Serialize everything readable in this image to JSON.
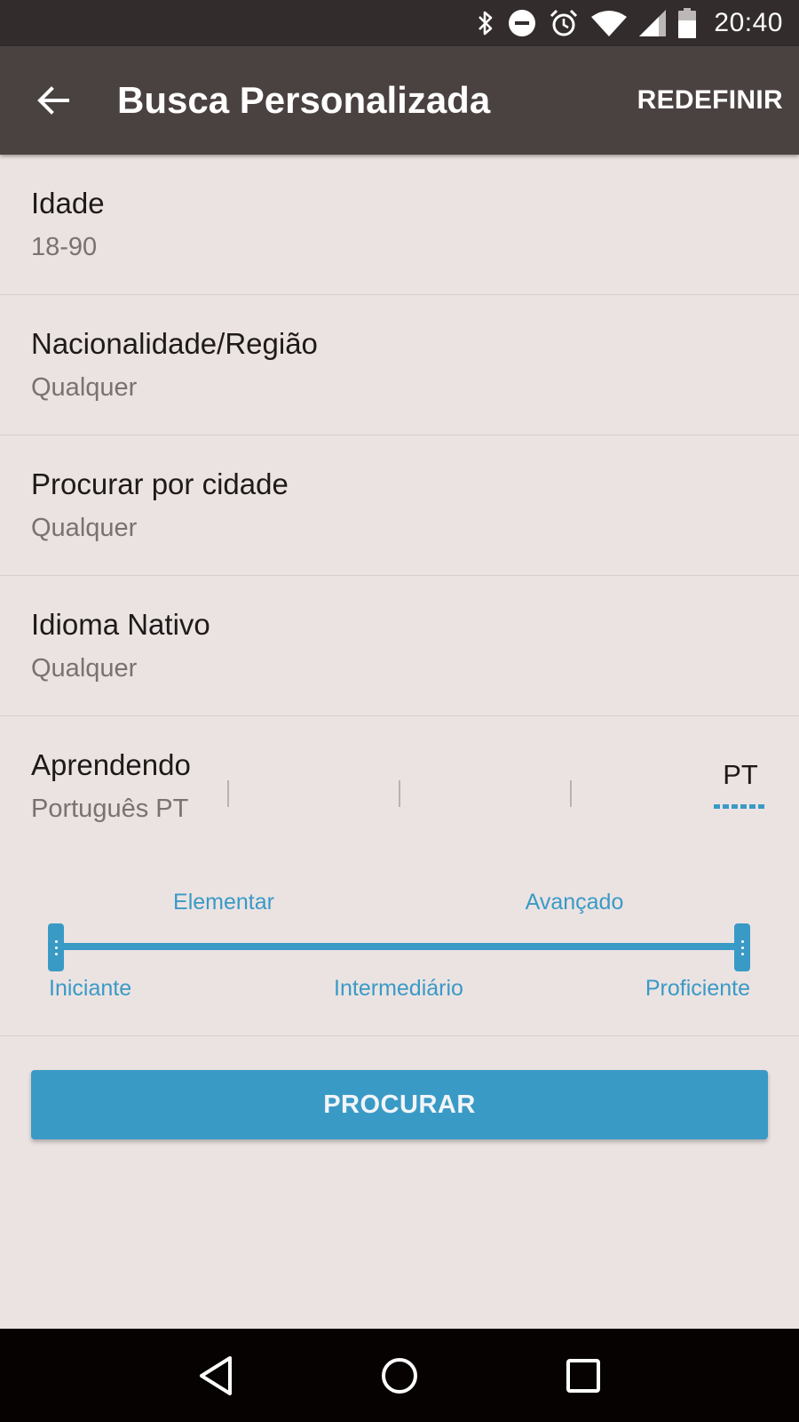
{
  "status_bar": {
    "time": "20:40",
    "icons": [
      "bluetooth-icon",
      "do-not-disturb-icon",
      "alarm-icon",
      "wifi-icon",
      "cell-signal-icon",
      "battery-icon"
    ]
  },
  "app_bar": {
    "title": "Busca Personalizada",
    "reset_label": "REDEFINIR",
    "back_icon": "arrow-back-icon"
  },
  "filters": [
    {
      "label": "Idade",
      "value": "18-90"
    },
    {
      "label": "Nacionalidade/Região",
      "value": "Qualquer"
    },
    {
      "label": "Procurar por cidade",
      "value": "Qualquer"
    },
    {
      "label": "Idioma Nativo",
      "value": "Qualquer"
    }
  ],
  "learning": {
    "label": "Aprendendo",
    "value": "Português  PT",
    "code": "PT"
  },
  "proficiency": {
    "levels_top": [
      "Elementar",
      "Avançado"
    ],
    "levels_bottom": [
      "Iniciante",
      "Intermediário",
      "Proficiente"
    ],
    "selected_min": "Iniciante",
    "selected_max": "Proficiente"
  },
  "search_button": {
    "label": "PROCURAR"
  },
  "colors": {
    "accent": "#3a9ac6",
    "app_bar": "#4a4241",
    "status_bar": "#332c2c",
    "background": "#ebe3e2"
  },
  "nav_bar": {
    "icons": [
      "nav-back-icon",
      "nav-home-icon",
      "nav-recents-icon"
    ]
  }
}
